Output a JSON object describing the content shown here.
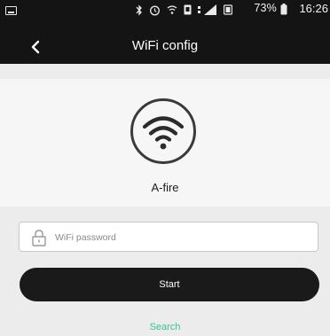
{
  "status_bar": {
    "battery": "73%",
    "time": "16:26"
  },
  "header": {
    "title": "WiFi config"
  },
  "device": {
    "name": "A-fire",
    "icon": "wifi-icon"
  },
  "form": {
    "password_placeholder": "WiFi password",
    "password_value": "",
    "start_label": "Start",
    "search_label": "Search"
  },
  "colors": {
    "bar_background": "#141414",
    "button_background": "#1a1a1a",
    "link": "#3bbf9a"
  }
}
